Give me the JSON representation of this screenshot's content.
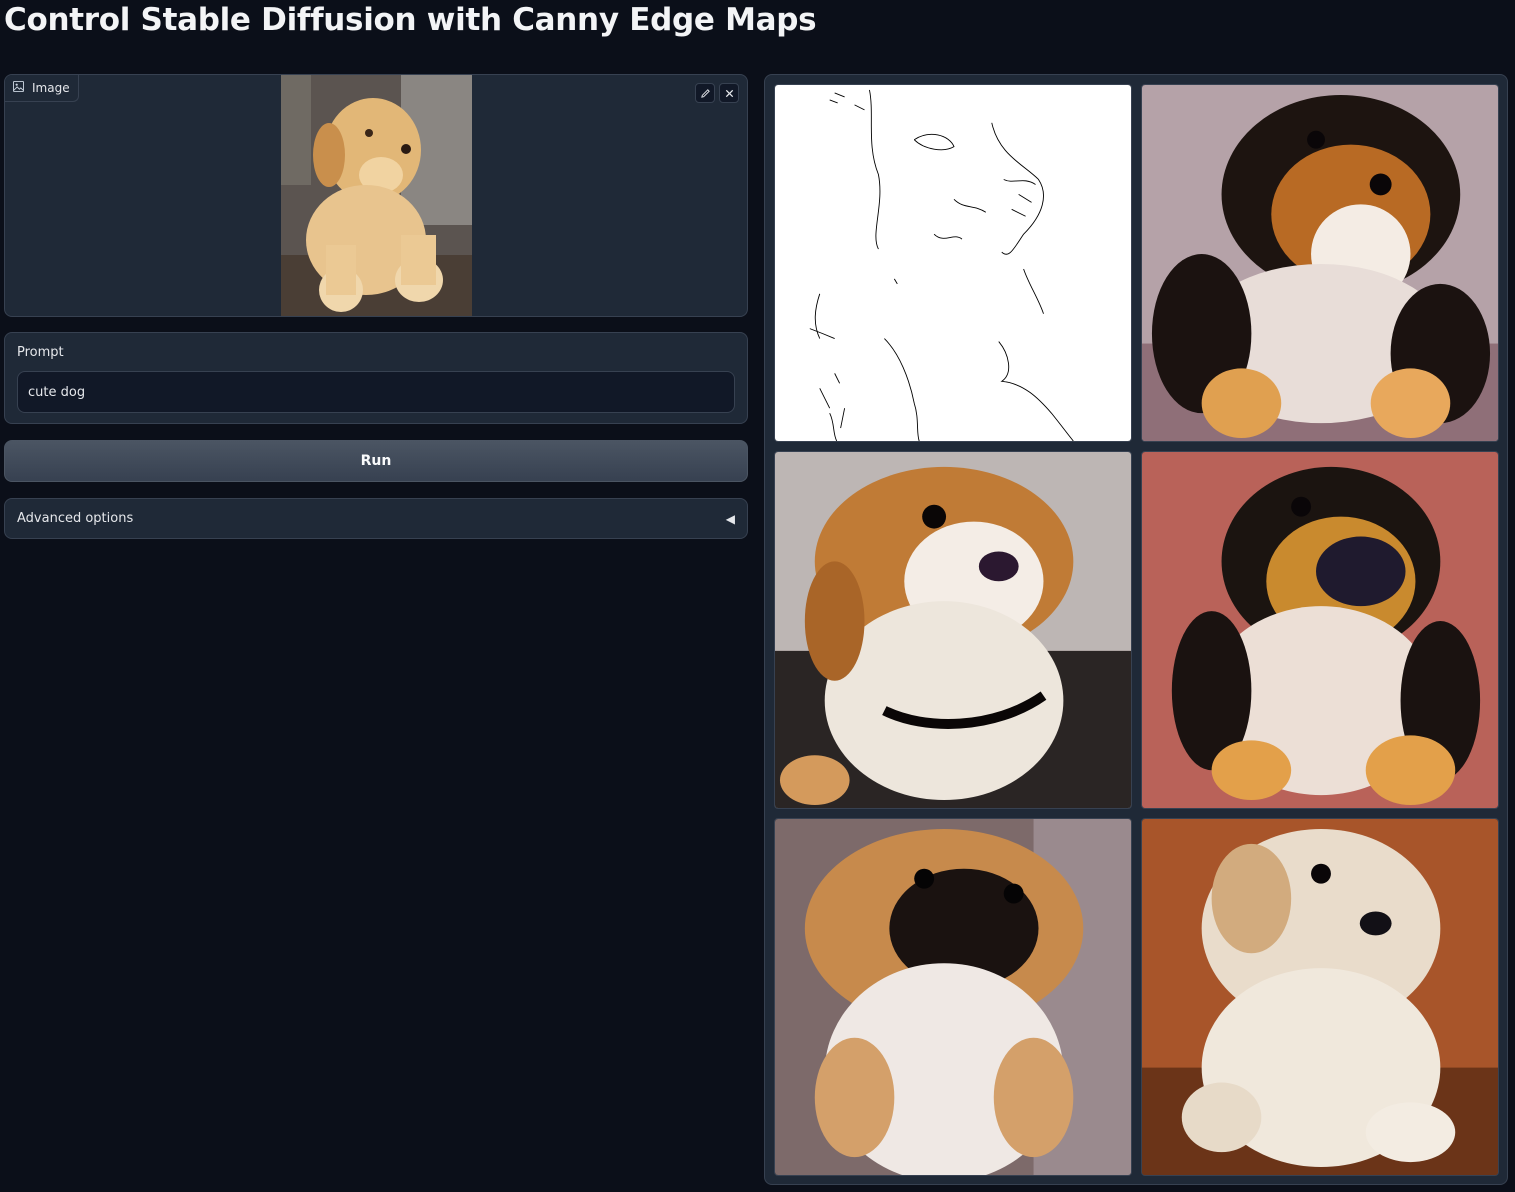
{
  "page": {
    "title": "Control Stable Diffusion with Canny Edge Maps"
  },
  "image_input": {
    "label": "Image",
    "label_icon": "image-icon",
    "edit_icon": "pencil-icon",
    "clear_icon": "close-icon"
  },
  "prompt": {
    "label": "Prompt",
    "value": "cute dog"
  },
  "run_button": {
    "label": "Run"
  },
  "advanced": {
    "label": "Advanced options",
    "arrow": "◀"
  },
  "colors": {
    "background": "#0b0f19",
    "panel": "#1f2937",
    "border": "#374151"
  }
}
